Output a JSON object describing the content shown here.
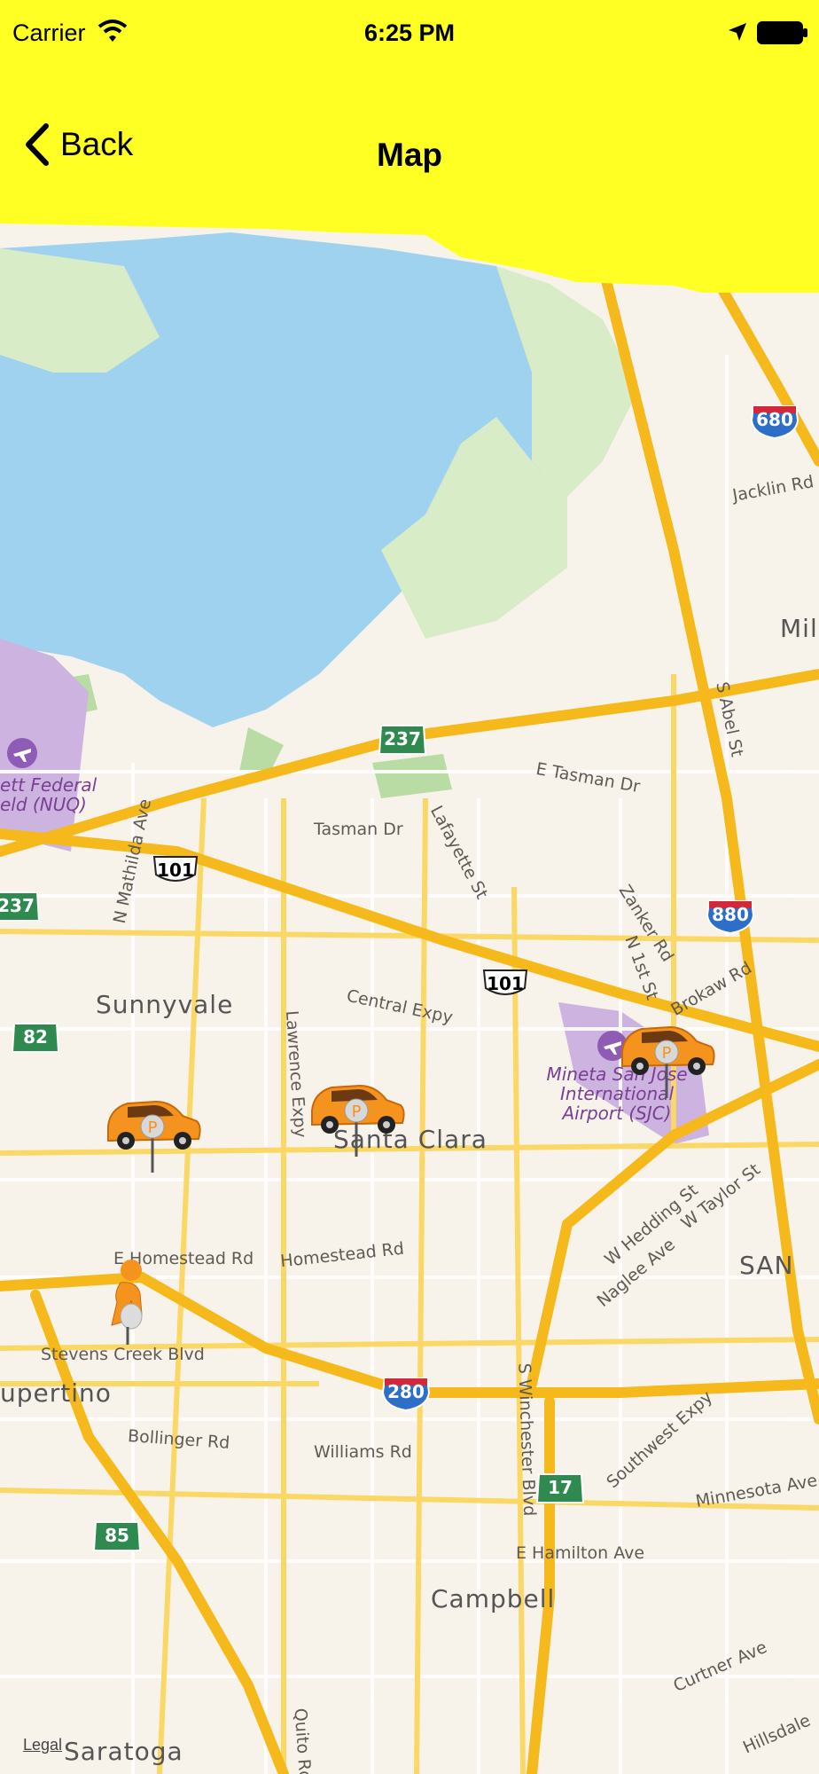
{
  "status_bar": {
    "carrier": "Carrier",
    "time": "6:25 PM"
  },
  "nav": {
    "back_label": "Back",
    "title": "Map"
  },
  "map": {
    "cities": [
      "Sunnyvale",
      "Santa Clara",
      "upertino",
      "Campbell",
      "Saratoga",
      "Mil",
      "SAN"
    ],
    "roads": [
      "Tasman Dr",
      "E Tasman Dr",
      "Lafayette St",
      "N Mathilda Ave",
      "Zanker Rd",
      "N 1st St",
      "S Abel St",
      "Jacklin Rd",
      "Central Expy",
      "Lawrence Expy",
      "E Homestead Rd",
      "Homestead Rd",
      "Stevens Creek Blvd",
      "Bollinger Rd",
      "Williams Rd",
      "S Winchester Blvd",
      "E Hamilton Ave",
      "Southwest Expy",
      "Minnesota Ave",
      "Curtner Ave",
      "Hillsdale",
      "Quito Rd",
      "W Hedding St",
      "Naglee Ave",
      "W Taylor St",
      "Brokaw Rd"
    ],
    "airports": [
      "ett Federal",
      "eld (NUQ)",
      "Mineta San Jose",
      "International",
      "Airport (SJC)"
    ],
    "shields": [
      "680",
      "237",
      "101",
      "237",
      "880",
      "101",
      "82",
      "280",
      "17",
      "85"
    ],
    "parking_pin_letter": "P",
    "legal": "Legal"
  }
}
